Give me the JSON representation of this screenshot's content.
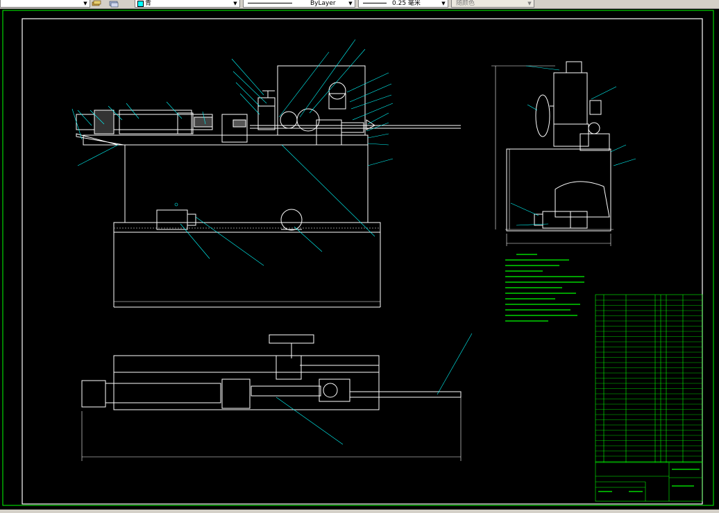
{
  "toolbar": {
    "layer_value": "青",
    "linetype_value": "ByLayer",
    "lineweight_value": "0.25 毫米",
    "plotstyle_value": "随颜色"
  },
  "icons": [
    "layer-icon",
    "layer-previous-icon",
    "dropdown-arrow-icon"
  ],
  "colors": {
    "background": "#000000",
    "frame": "#ffffff",
    "lines": "#ffffff",
    "leaders": "#00ffff",
    "notes": "#00ff00",
    "title_block": "#00ff00"
  }
}
